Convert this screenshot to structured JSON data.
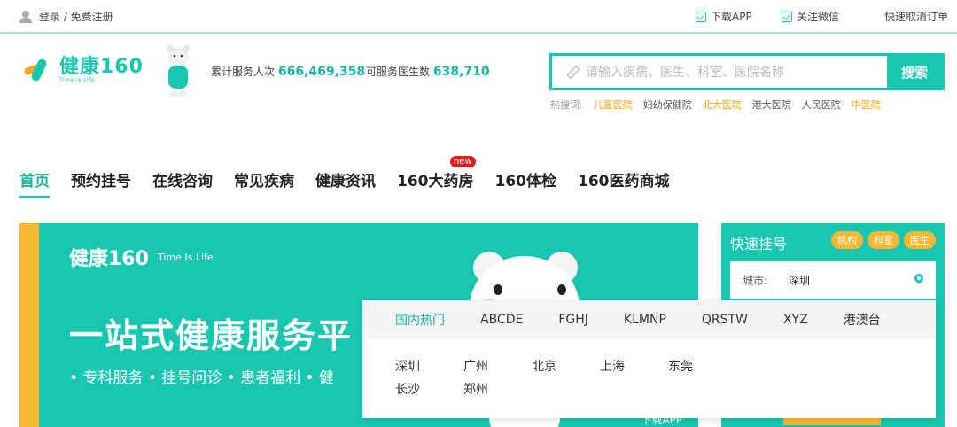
{
  "topbar": {
    "login": "登录 / 免费注册",
    "download_app": "下载APP",
    "follow_wechat": "关注微信",
    "cancel_order": "快速取消订单"
  },
  "header": {
    "logo_text": "健康160",
    "logo_sub": "Time is Life",
    "stat1_label": "累计服务人次",
    "stat1_value": "666,469,358",
    "stat2_label": "可服务医生数",
    "stat2_value": "638,710",
    "search_placeholder": "请输入疾病、医生、科室、医院名称",
    "search_button": "搜索",
    "hot_label": "热搜词:",
    "hot_words": [
      {
        "text": "儿童医院",
        "hl": true
      },
      {
        "text": "妇幼保健院",
        "hl": false
      },
      {
        "text": "北大医院",
        "hl": true
      },
      {
        "text": "港大医院",
        "hl": false
      },
      {
        "text": "人民医院",
        "hl": false
      },
      {
        "text": "中医院",
        "hl": true
      }
    ]
  },
  "nav": {
    "items": [
      "首页",
      "预约挂号",
      "在线咨询",
      "常见疾病",
      "健康资讯",
      "160大药房",
      "160体检",
      "160医药商城"
    ],
    "new_badge": "new"
  },
  "banner": {
    "logo": "健康160",
    "logo_tag": "Time Is Life",
    "headline": "一站式健康服务平",
    "bullets": "• 专科服务  • 挂号问诊  • 患者福利  • 健",
    "download": "下载APP"
  },
  "quick": {
    "title": "快速挂号",
    "tags": [
      "机构",
      "科室",
      "医生"
    ],
    "city_label": "城市:",
    "city_value": "深圳"
  },
  "dropdown": {
    "tabs": [
      "国内热门",
      "ABCDE",
      "FGHJ",
      "KLMNP",
      "QRSTW",
      "XYZ",
      "港澳台"
    ],
    "active_tab": 0,
    "cities": [
      "深圳",
      "广州",
      "北京",
      "上海",
      "东莞",
      "长沙",
      "郑州"
    ]
  },
  "colors": {
    "accent": "#19c7b1",
    "yellow": "#f7b733",
    "badge": "#e02020"
  }
}
